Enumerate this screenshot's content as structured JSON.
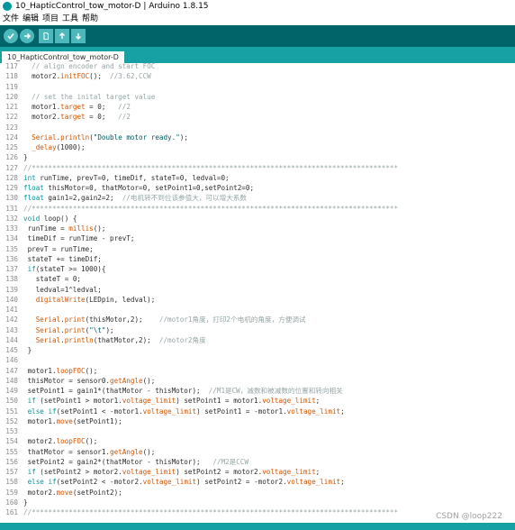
{
  "window": {
    "title": "10_HapticControl_tow_motor-D | Arduino 1.8.15"
  },
  "menu": [
    "文件",
    "编辑",
    "项目",
    "工具",
    "帮助"
  ],
  "tabs": [
    {
      "label": "10_HapticControl_tow_motor-D"
    }
  ],
  "toolbar": {
    "buttons": [
      "verify-icon",
      "upload-icon",
      "new-icon",
      "open-icon",
      "save-icon"
    ]
  },
  "colors": {
    "toolbar": "#006468",
    "tabstrip": "#17a1a5",
    "keyword": "#00979c",
    "function": "#d35400",
    "comment": "#95a5a6"
  },
  "code": [
    {
      "n": "117",
      "t": "  // align encoder and start FOC"
    },
    {
      "n": "118",
      "t": "  motor2.initFOC();  //3.62,CCW"
    },
    {
      "n": "119",
      "t": ""
    },
    {
      "n": "120",
      "t": "  // set the inital target value"
    },
    {
      "n": "121",
      "t": "  motor1.target = 0;   //2"
    },
    {
      "n": "122",
      "t": "  motor2.target = 0;   //2"
    },
    {
      "n": "123",
      "t": ""
    },
    {
      "n": "124",
      "t": "  Serial.println(\"Double motor ready.\");"
    },
    {
      "n": "125",
      "t": "  _delay(1000);"
    },
    {
      "n": "126",
      "t": "}"
    },
    {
      "n": "127",
      "t": "//*****************************************************************************************"
    },
    {
      "n": "128",
      "t": "int runTime, prevT=0, timeDif, stateT=0, ledval=0;"
    },
    {
      "n": "129",
      "t": "float thisMotor=0, thatMotor=0, setPoint1=0,setPoint2=0;"
    },
    {
      "n": "130",
      "t": "float gain1=2,gain2=2;  //电机转不到位该参值大，可以增大系数"
    },
    {
      "n": "131",
      "t": "//*****************************************************************************************"
    },
    {
      "n": "132",
      "t": "void loop() {"
    },
    {
      "n": "133",
      "t": " runTime = millis();"
    },
    {
      "n": "134",
      "t": " timeDif = runTime - prevT;"
    },
    {
      "n": "135",
      "t": " prevT = runTime;"
    },
    {
      "n": "136",
      "t": " stateT += timeDif;"
    },
    {
      "n": "137",
      "t": " if(stateT >= 1000){"
    },
    {
      "n": "138",
      "t": "   stateT = 0;"
    },
    {
      "n": "139",
      "t": "   ledval=1^ledval;"
    },
    {
      "n": "140",
      "t": "   digitalWrite(LEDpin, ledval);"
    },
    {
      "n": "141",
      "t": ""
    },
    {
      "n": "142",
      "t": "   Serial.print(thisMotor,2);    //motor1角度，打印2个电机的角度，方便调试"
    },
    {
      "n": "143",
      "t": "   Serial.print(\"\\t\");"
    },
    {
      "n": "144",
      "t": "   Serial.println(thatMotor,2);  //motor2角度"
    },
    {
      "n": "145",
      "t": " }"
    },
    {
      "n": "146",
      "t": ""
    },
    {
      "n": "147",
      "t": " motor1.loopFOC();"
    },
    {
      "n": "148",
      "t": " thisMotor = sensor0.getAngle();"
    },
    {
      "n": "149",
      "t": " setPoint1 = gain1*(thatMotor - thisMotor);  //M1是CW，减数和被减数的位置和转向相关"
    },
    {
      "n": "150",
      "t": " if (setPoint1 > motor1.voltage_limit) setPoint1 = motor1.voltage_limit;"
    },
    {
      "n": "151",
      "t": " else if(setPoint1 < -motor1.voltage_limit) setPoint1 = -motor1.voltage_limit;"
    },
    {
      "n": "152",
      "t": " motor1.move(setPoint1);"
    },
    {
      "n": "153",
      "t": ""
    },
    {
      "n": "154",
      "t": " motor2.loopFOC();"
    },
    {
      "n": "155",
      "t": " thatMotor = sensor1.getAngle();"
    },
    {
      "n": "156",
      "t": " setPoint2 = gain2*(thatMotor - thisMotor);   //M2是CCW"
    },
    {
      "n": "157",
      "t": " if (setPoint2 > motor2.voltage_limit) setPoint2 = motor2.voltage_limit;"
    },
    {
      "n": "158",
      "t": " else if(setPoint2 < -motor2.voltage_limit) setPoint2 = -motor2.voltage_limit;"
    },
    {
      "n": "159",
      "t": " motor2.move(setPoint2);"
    },
    {
      "n": "160",
      "t": "}"
    },
    {
      "n": "161",
      "t": "//*****************************************************************************************"
    }
  ],
  "watermark": "CSDN @loop222"
}
